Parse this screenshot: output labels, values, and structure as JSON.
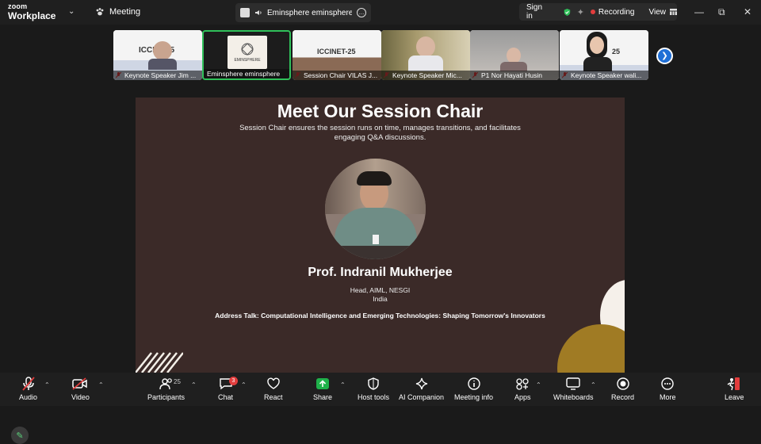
{
  "app": {
    "brand_top": "zoom",
    "brand_bottom": "Workplace",
    "meeting_label": "Meeting"
  },
  "share_pill": {
    "title": "Eminsphere eminsphere's screen"
  },
  "status": {
    "sign_in": "Sign in",
    "recording": "Recording",
    "view": "View"
  },
  "thumbnails": [
    {
      "name": "Keynote Speaker Jim ...",
      "slide_text": "ICCI ... 25"
    },
    {
      "name": "Eminsphere eminsphere",
      "logo_text": "EMINSPHERE"
    },
    {
      "name": "Session Chair VILAS J...",
      "slide_text": "ICCINET-25"
    },
    {
      "name": "Keynote Speaker Mic..."
    },
    {
      "name": "P1 Nor Hayati Husin"
    },
    {
      "name": "Keynote Speaker wali...",
      "slide_text": "25"
    }
  ],
  "slide": {
    "title": "Meet Our Session Chair",
    "subtitle": "Session Chair ensures the session runs on time, manages transitions, and facilitates engaging Q&A discussions.",
    "name": "Prof. Indranil Mukherjee",
    "role": "Head, AIML, NESGI",
    "country": "India",
    "talk": "Address Talk: Computational Intelligence and Emerging Technologies: Shaping Tomorrow's Innovators"
  },
  "toolbar": {
    "audio": "Audio",
    "video": "Video",
    "participants": "Participants",
    "participant_count": "25",
    "chat": "Chat",
    "chat_badge": "3",
    "react": "React",
    "share": "Share",
    "host_tools": "Host tools",
    "ai_companion": "AI Companion",
    "meeting_info": "Meeting info",
    "apps": "Apps",
    "whiteboards": "Whiteboards",
    "record": "Record",
    "more": "More",
    "leave": "Leave"
  },
  "colors": {
    "accent_green": "#30c05a",
    "share_green": "#1fb14a",
    "leave_red": "#e23d3d",
    "slide_bg": "#3b2a28",
    "next_blue": "#1f6fd6"
  }
}
